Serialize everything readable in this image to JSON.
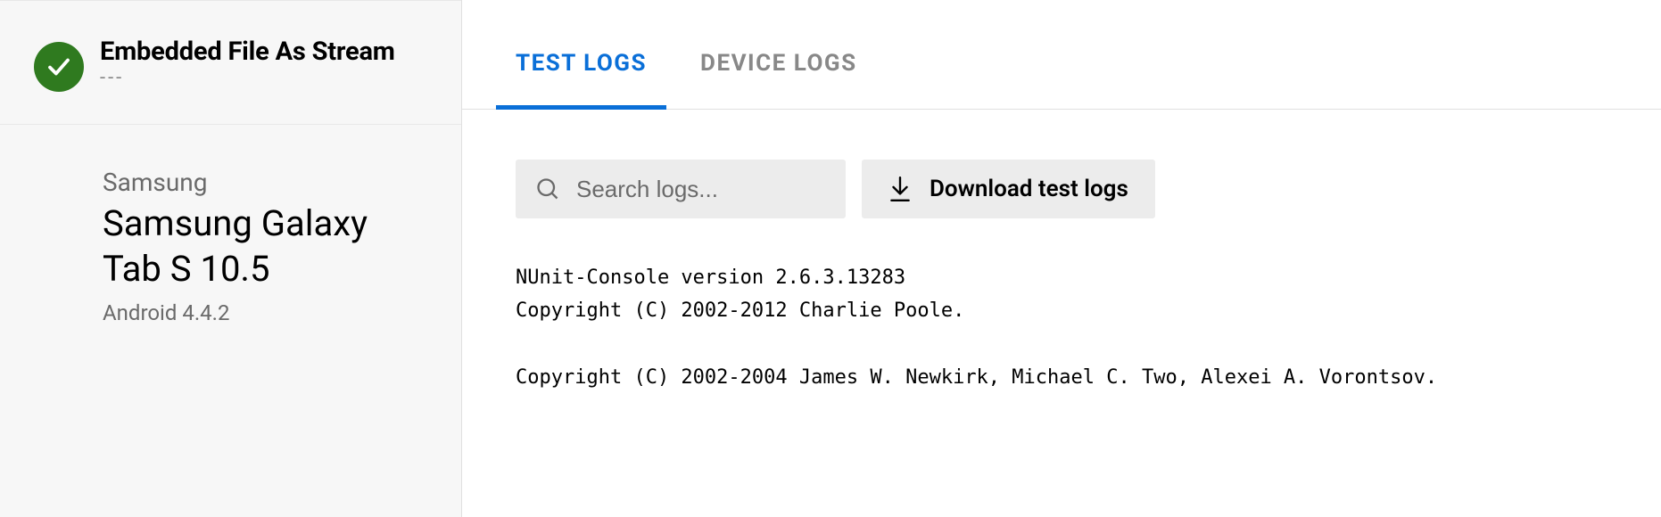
{
  "sidebar": {
    "test_title": "Embedded File As Stream",
    "test_subtitle": "---",
    "device": {
      "brand": "Samsung",
      "name": "Samsung Galaxy Tab S 10.5",
      "os": "Android 4.4.2"
    }
  },
  "tabs": {
    "test_logs": "TEST LOGS",
    "device_logs": "DEVICE LOGS"
  },
  "controls": {
    "search_placeholder": "Search logs...",
    "download_label": "Download test logs"
  },
  "log_output": "NUnit-Console version 2.6.3.13283\nCopyright (C) 2002-2012 Charlie Poole.\n\nCopyright (C) 2002-2004 James W. Newkirk, Michael C. Two, Alexei A. Vorontsov."
}
